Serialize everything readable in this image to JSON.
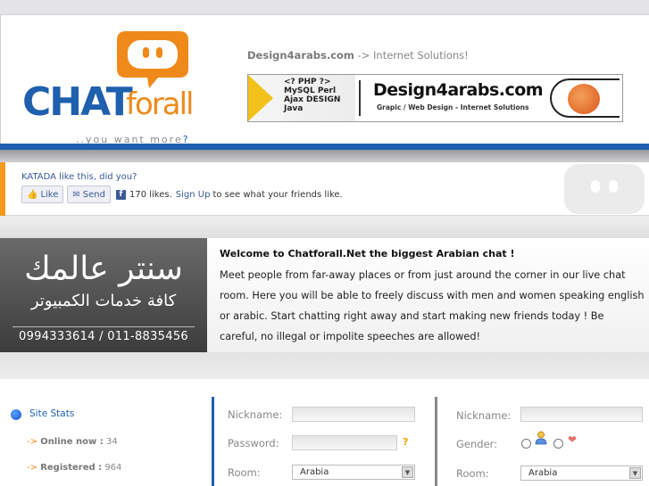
{
  "header": {
    "logo": {
      "chat": "CHAT",
      "forall": "forall",
      "tagline": "..you want more",
      "tagline_q": "?"
    },
    "site_link": {
      "name": "Design4arabs.com",
      "arrow": " -> ",
      "desc": "Internet Solutions!"
    },
    "banner": {
      "tech_words": [
        "<? PHP ?>",
        "MySQL Perl",
        "Ajax DESIGN",
        "Java"
      ],
      "site": "Design4arabs.com",
      "subtitle": "Grapic / Web Design - Internet Solutions"
    }
  },
  "facebook": {
    "user_line": "KATADA like this, did you?",
    "like_label": "Like",
    "send_label": "Send",
    "count_text": "170 likes.",
    "signup_label": "Sign Up",
    "tail_text": "to see what your friends like."
  },
  "ad": {
    "line1": "سنتر عالمك",
    "line2": "كافة خدمات الكمبيوتر",
    "phones": "0994333614 / 011-8835456"
  },
  "welcome": {
    "title": "Welcome to Chatforall.Net the biggest Arabian chat !",
    "body": "Meet people from far-away places or from just around the corner in our live chat room. Here you will be able to freely discuss with men and women speaking english or arabic. Start chatting right away and start making new friends today ! Be careful, no illegal or impolite speeches are allowed!"
  },
  "stats": {
    "title": "Site Stats",
    "online_label": "Online now :",
    "online_value": "34",
    "registered_label": "Registered :",
    "registered_value": "964",
    "arrow": "->"
  },
  "login_form": {
    "nickname_label": "Nickname:",
    "password_label": "Password:",
    "room_label": "Room:",
    "room_value": "Arabia",
    "help": "?"
  },
  "guest_form": {
    "nickname_label": "Nickname:",
    "gender_label": "Gender:",
    "room_label": "Room:",
    "room_value": "Arabia"
  },
  "colors": {
    "brand_blue": "#1e5fae",
    "brand_orange": "#ef8a1a",
    "facebook_blue": "#3b5998"
  }
}
